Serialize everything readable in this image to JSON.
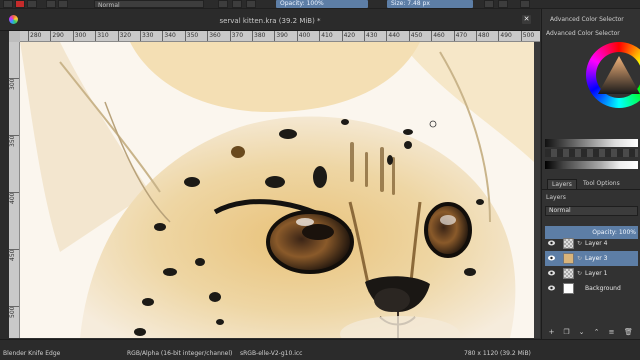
{
  "toolbar": {
    "blend_mode": "Normal",
    "opacity_label": "Opacity: 100%",
    "size_label": "Size: 7.48 px"
  },
  "document": {
    "title": "serval kitten.kra (39.2 MiB) *"
  },
  "rulers": {
    "horizontal_labels": [
      "280",
      "290",
      "300",
      "310",
      "320",
      "330",
      "340",
      "350",
      "360",
      "370",
      "380",
      "390",
      "400",
      "410",
      "420",
      "430",
      "440",
      "450",
      "460",
      "470",
      "480",
      "490",
      "500"
    ],
    "vertical_labels": [
      "300",
      "350",
      "400",
      "450",
      "500"
    ]
  },
  "dock": {
    "color_selector_title": "Advanced Color Selector",
    "color_selector_header": "Advanced Color Selector",
    "tabs": [
      {
        "label": "Layers",
        "active": true
      },
      {
        "label": "Tool Options",
        "active": false
      }
    ],
    "layers_header": "Layers",
    "blend_mode": "Normal",
    "opacity_label": "Opacity: 100%",
    "layers": [
      {
        "name": "Layer 4",
        "selected": false,
        "thumb": "check"
      },
      {
        "name": "Layer 3",
        "selected": true,
        "thumb": "art"
      },
      {
        "name": "Layer 1",
        "selected": false,
        "thumb": "check"
      },
      {
        "name": "Background",
        "selected": false,
        "thumb": "white"
      }
    ]
  },
  "status": {
    "brush": "Blender Knife Edge",
    "color_model": "RGB/Alpha (16-bit integer/channel)",
    "profile": "sRGB-elle-V2-g10.icc",
    "image_size": "780 x 1120 (39.2 MiB)"
  },
  "colors": {
    "accent": "#5d7ea6",
    "panel": "#323232",
    "fur": "#e7c98e",
    "spots": "#1c1a16"
  }
}
